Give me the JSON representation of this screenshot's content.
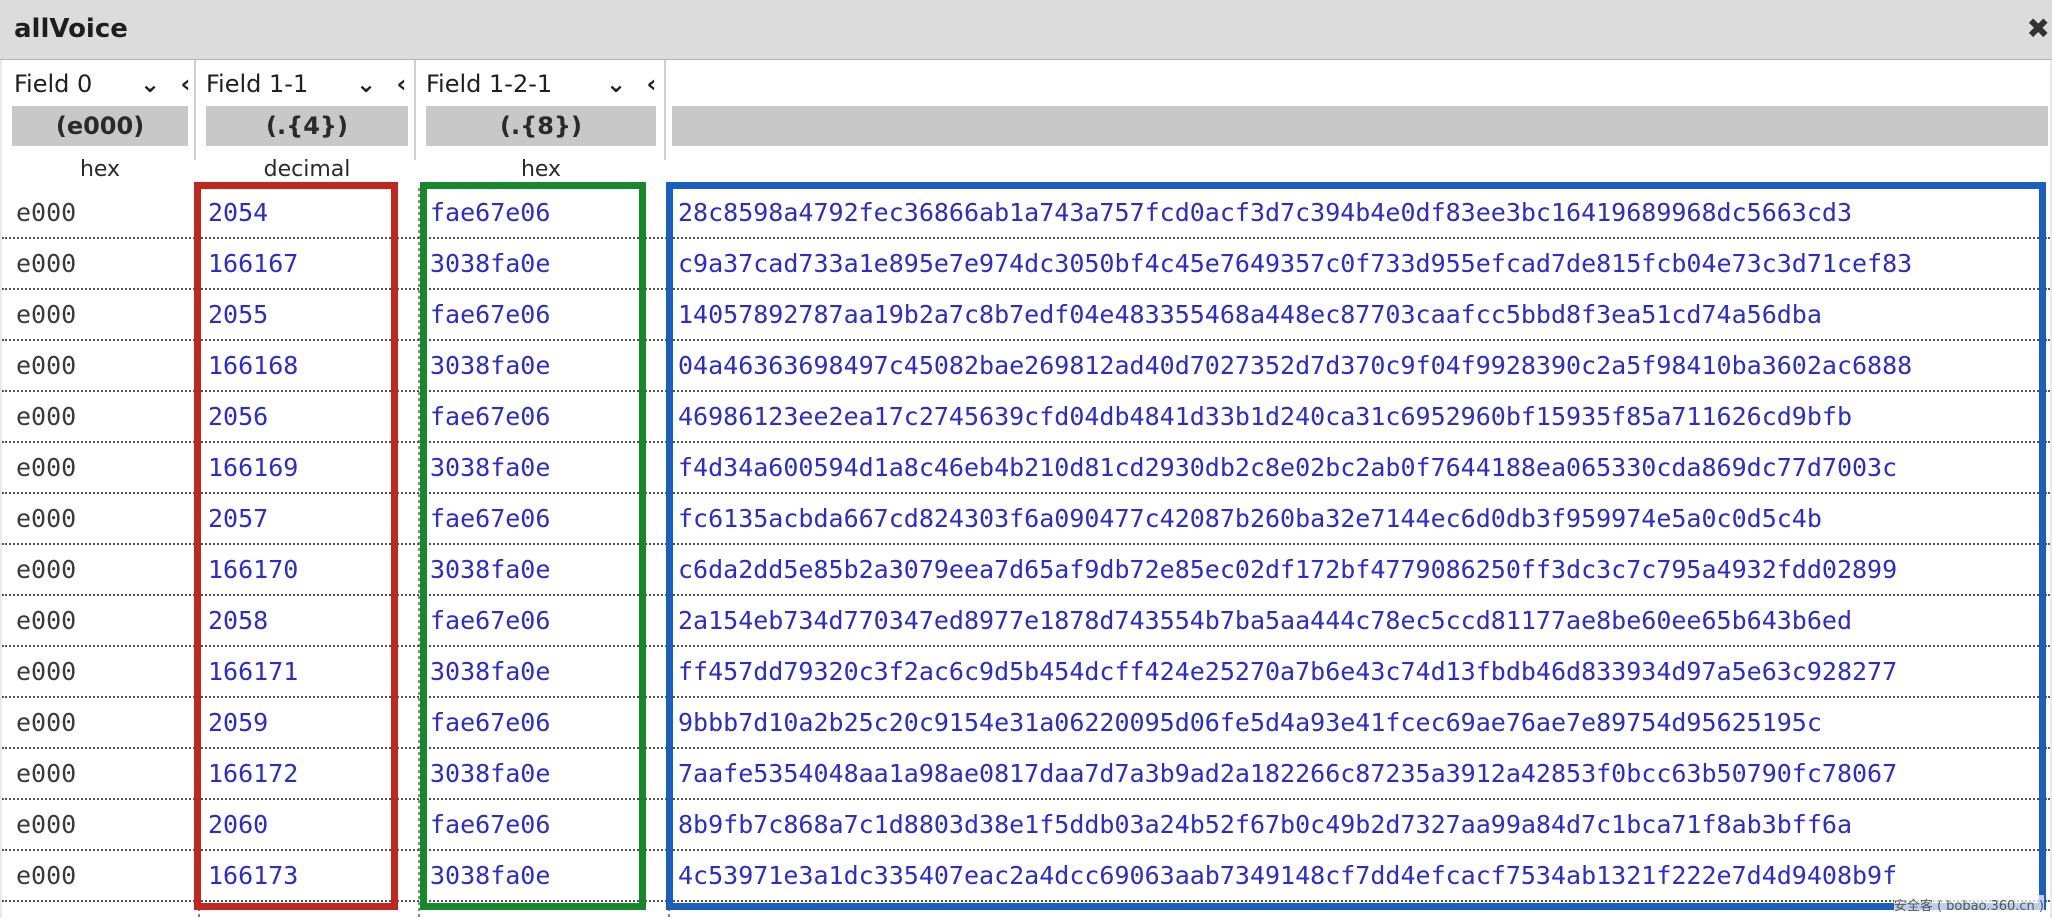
{
  "window": {
    "title": "allVoice",
    "close_glyph": "✖"
  },
  "fields": [
    {
      "name": "Field 0",
      "regex": "(e000)",
      "format": "hex"
    },
    {
      "name": "Field 1-1",
      "regex": "(.{4})",
      "format": "decimal"
    },
    {
      "name": "Field 1-2-1",
      "regex": "(.{8})",
      "format": "hex"
    },
    {
      "name": "",
      "regex": "",
      "format": ""
    }
  ],
  "field_controls": "⌄ ‹",
  "rows": [
    [
      "e000",
      "2054",
      "fae67e06",
      "28c8598a4792fec36866ab1a743a757fcd0acf3d7c394b4e0df83ee3bc16419689968dc5663cd3"
    ],
    [
      "e000",
      "166167",
      "3038fa0e",
      "c9a37cad733a1e895e7e974dc3050bf4c45e7649357c0f733d955efcad7de815fcb04e73c3d71cef83"
    ],
    [
      "e000",
      "2055",
      "fae67e06",
      "14057892787aa19b2a7c8b7edf04e483355468a448ec87703caafcc5bbd8f3ea51cd74a56dba"
    ],
    [
      "e000",
      "166168",
      "3038fa0e",
      "04a46363698497c45082bae269812ad40d7027352d7d370c9f04f9928390c2a5f98410ba3602ac6888"
    ],
    [
      "e000",
      "2056",
      "fae67e06",
      "46986123ee2ea17c2745639cfd04db4841d33b1d240ca31c6952960bf15935f85a711626cd9bfb"
    ],
    [
      "e000",
      "166169",
      "3038fa0e",
      "f4d34a600594d1a8c46eb4b210d81cd2930db2c8e02bc2ab0f7644188ea065330cda869dc77d7003c"
    ],
    [
      "e000",
      "2057",
      "fae67e06",
      "fc6135acbda667cd824303f6a090477c42087b260ba32e7144ec6d0db3f959974e5a0c0d5c4b"
    ],
    [
      "e000",
      "166170",
      "3038fa0e",
      "c6da2dd5e85b2a3079eea7d65af9db72e85ec02df172bf4779086250ff3dc3c7c795a4932fdd02899"
    ],
    [
      "e000",
      "2058",
      "fae67e06",
      "2a154eb734d770347ed8977e1878d743554b7ba5aa444c78ec5ccd81177ae8be60ee65b643b6ed"
    ],
    [
      "e000",
      "166171",
      "3038fa0e",
      "ff457dd79320c3f2ac6c9d5b454dcff424e25270a7b6e43c74d13fbdb46d833934d97a5e63c928277"
    ],
    [
      "e000",
      "2059",
      "fae67e06",
      "9bbb7d10a2b25c20c9154e31a06220095d06fe5d4a93e41fcec69ae76ae7e89754d95625195c"
    ],
    [
      "e000",
      "166172",
      "3038fa0e",
      "7aafe5354048aa1a98ae0817daa7d7a3b9ad2a182266c87235a3912a42853f0bcc63b50790fc78067"
    ],
    [
      "e000",
      "2060",
      "fae67e06",
      "8b9fb7c868a7c1d8803d38e1f5ddb03a24b52f67b0c49b2d7327aa99a84d7c1bca71f8ab3bff6a"
    ],
    [
      "e000",
      "166173",
      "3038fa0e",
      "4c53971e3a1dc335407eac2a4dcc69063aab7349148cf7dd4efcacf7534ab1321f222e7d4d9408b9f"
    ]
  ],
  "highlights": {
    "red": "#c0281e",
    "green": "#168a2a",
    "blue": "#1a5fc0"
  },
  "watermark": "安全客 ( bobao.360.cn )"
}
